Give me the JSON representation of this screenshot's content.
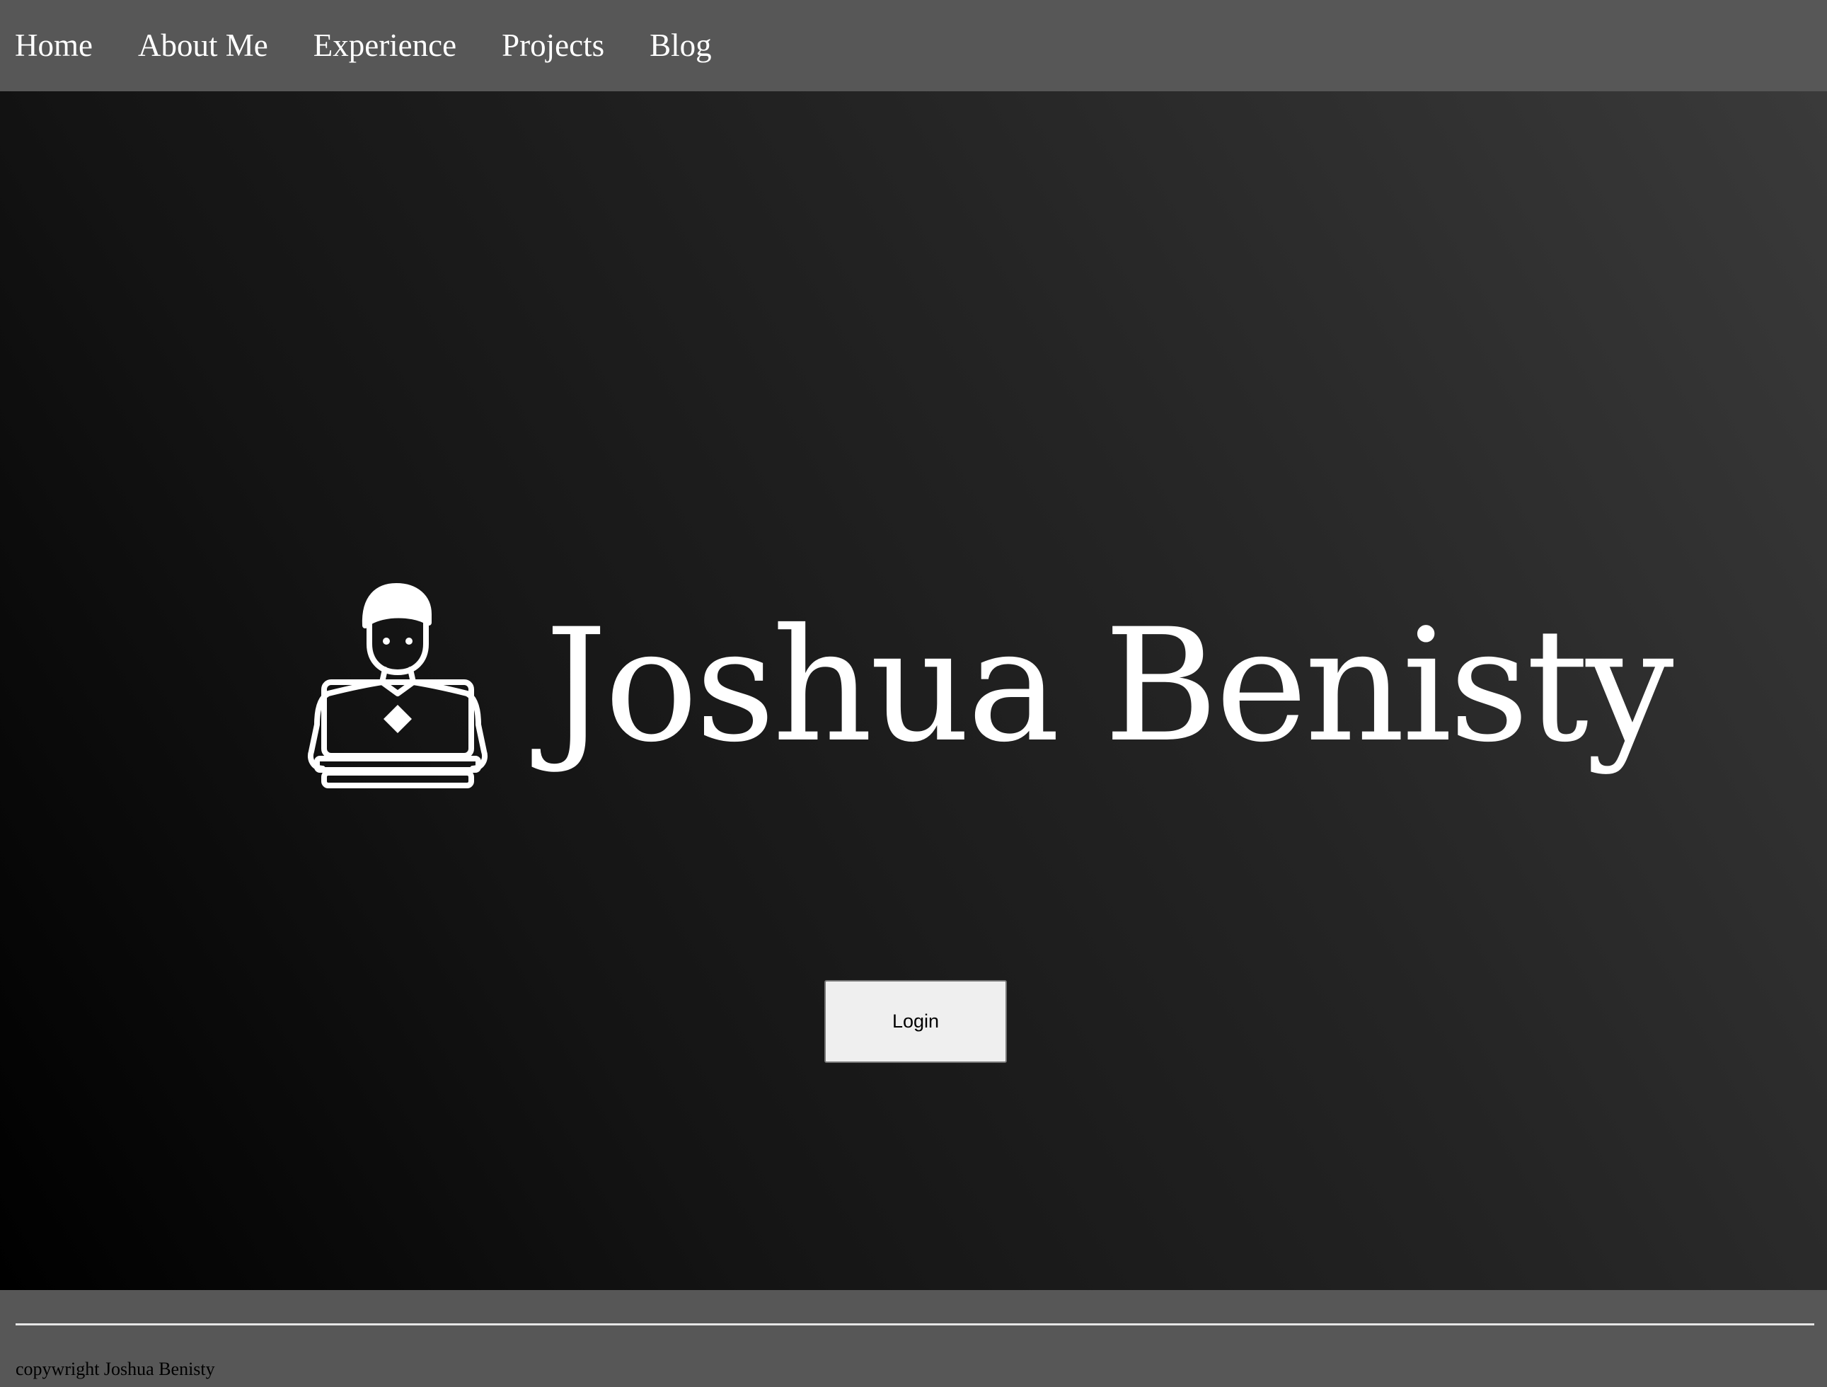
{
  "nav": {
    "items": [
      {
        "label": "Home"
      },
      {
        "label": "About Me"
      },
      {
        "label": "Experience"
      },
      {
        "label": "Projects"
      },
      {
        "label": "Blog"
      }
    ]
  },
  "hero": {
    "logo_text": "Joshua Benisty",
    "logo_icon": "person-with-laptop-icon",
    "login_label": "Login"
  },
  "footer": {
    "text": "copywright Joshua Benisty"
  },
  "colors": {
    "nav_background": "#575757",
    "footer_background": "#575757",
    "hero_gradient_start": "#000000",
    "hero_gradient_end": "#3a3a3a",
    "text_light": "#ffffff",
    "button_background": "#efefef"
  }
}
